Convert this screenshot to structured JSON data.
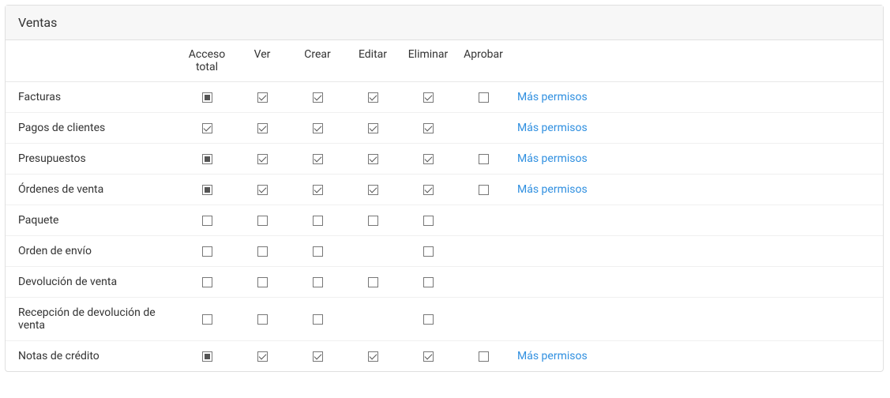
{
  "section": {
    "title": "Ventas"
  },
  "columns": {
    "label": "",
    "acceso_total": "Acceso total",
    "ver": "Ver",
    "crear": "Crear",
    "editar": "Editar",
    "eliminar": "Eliminar",
    "aprobar": "Aprobar",
    "more": ""
  },
  "more_permissions_label": "Más permisos",
  "rows": [
    {
      "label": "Facturas",
      "perms": {
        "acceso_total": "indeterminate",
        "ver": "checked",
        "crear": "checked",
        "editar": "checked",
        "eliminar": "checked",
        "aprobar": "unchecked"
      },
      "more": true
    },
    {
      "label": "Pagos de clientes",
      "perms": {
        "acceso_total": "checked",
        "ver": "checked",
        "crear": "checked",
        "editar": "checked",
        "eliminar": "checked",
        "aprobar": null
      },
      "more": true
    },
    {
      "label": "Presupuestos",
      "perms": {
        "acceso_total": "indeterminate",
        "ver": "checked",
        "crear": "checked",
        "editar": "checked",
        "eliminar": "checked",
        "aprobar": "unchecked"
      },
      "more": true
    },
    {
      "label": "Órdenes de venta",
      "perms": {
        "acceso_total": "indeterminate",
        "ver": "checked",
        "crear": "checked",
        "editar": "checked",
        "eliminar": "checked",
        "aprobar": "unchecked"
      },
      "more": true
    },
    {
      "label": "Paquete",
      "perms": {
        "acceso_total": "unchecked",
        "ver": "unchecked",
        "crear": "unchecked",
        "editar": "unchecked",
        "eliminar": "unchecked",
        "aprobar": null
      },
      "more": false
    },
    {
      "label": "Orden de envío",
      "perms": {
        "acceso_total": "unchecked",
        "ver": "unchecked",
        "crear": "unchecked",
        "editar": null,
        "eliminar": "unchecked",
        "aprobar": null
      },
      "more": false
    },
    {
      "label": "Devolución de venta",
      "perms": {
        "acceso_total": "unchecked",
        "ver": "unchecked",
        "crear": "unchecked",
        "editar": "unchecked",
        "eliminar": "unchecked",
        "aprobar": null
      },
      "more": false
    },
    {
      "label": "Recepción de devolución de venta",
      "perms": {
        "acceso_total": "unchecked",
        "ver": "unchecked",
        "crear": "unchecked",
        "editar": null,
        "eliminar": "unchecked",
        "aprobar": null
      },
      "more": false
    },
    {
      "label": "Notas de crédito",
      "perms": {
        "acceso_total": "indeterminate",
        "ver": "checked",
        "crear": "checked",
        "editar": "checked",
        "eliminar": "checked",
        "aprobar": "unchecked"
      },
      "more": true
    }
  ]
}
